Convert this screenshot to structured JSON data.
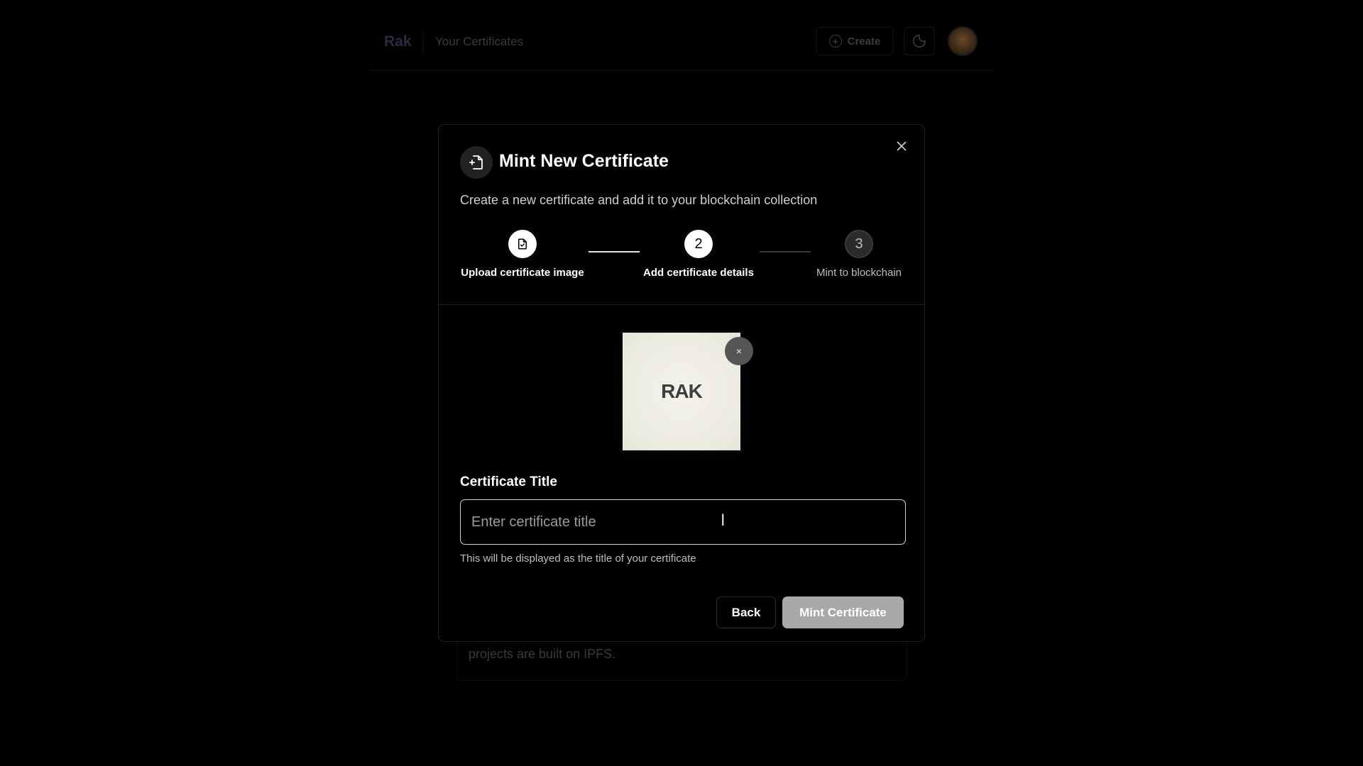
{
  "nav": {
    "brand": "Rak",
    "title": "Your Certificates",
    "create_label": "Create",
    "theme_icon": "moon-sun-icon",
    "avatar": "user-avatar"
  },
  "background": {
    "card_text": "projects are built on IPFS."
  },
  "modal": {
    "header_icon": "file-plus-icon",
    "title": "Mint New Certificate",
    "subtitle": "Create a new certificate and add it to your blockchain collection",
    "close_icon": "close-icon",
    "steps": [
      {
        "number": "",
        "icon": "file-check-icon",
        "label": "Upload certificate image",
        "state": "done"
      },
      {
        "number": "2",
        "label": "Add certificate details",
        "state": "active"
      },
      {
        "number": "3",
        "label": "Mint to blockchain",
        "state": "pending"
      }
    ],
    "preview": {
      "logo_text": "RAK",
      "remove_label": "×"
    },
    "form": {
      "label": "Certificate Title",
      "placeholder": "Enter certificate title",
      "value": "",
      "helper": "This will be displayed as the title of your certificate"
    },
    "buttons": {
      "back": "Back",
      "mint": "Mint Certificate"
    }
  }
}
